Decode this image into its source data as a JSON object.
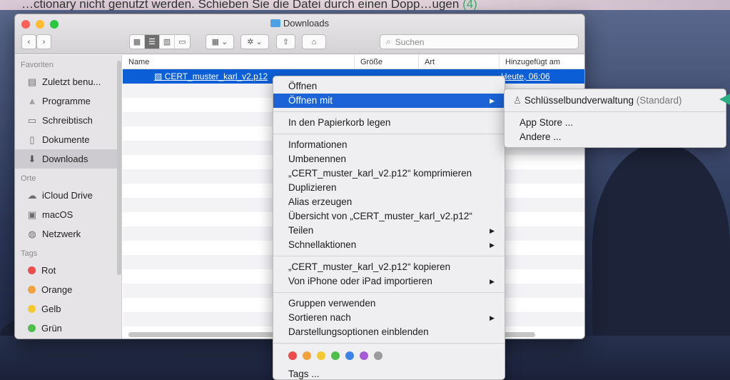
{
  "wallpaper": {
    "caption_main": "…ctionary nicht genutzt werden. Schieben Sie die Datei durch einen Dopp…ugen",
    "caption_accent": "(4)"
  },
  "window": {
    "title": "Downloads",
    "search_placeholder": "Suchen"
  },
  "sidebar": {
    "sections": [
      {
        "title": "Favoriten",
        "items": [
          {
            "label": "Zuletzt benu...",
            "icon": "clock-icon"
          },
          {
            "label": "Programme",
            "icon": "applications-icon"
          },
          {
            "label": "Schreibtisch",
            "icon": "desktop-icon"
          },
          {
            "label": "Dokumente",
            "icon": "document-icon"
          },
          {
            "label": "Downloads",
            "icon": "download-icon",
            "selected": true
          }
        ]
      },
      {
        "title": "Orte",
        "items": [
          {
            "label": "iCloud Drive",
            "icon": "cloud-icon"
          },
          {
            "label": "macOS",
            "icon": "disk-icon"
          },
          {
            "label": "Netzwerk",
            "icon": "network-icon"
          }
        ]
      },
      {
        "title": "Tags",
        "items": [
          {
            "label": "Rot",
            "color": "#ec4c4c"
          },
          {
            "label": "Orange",
            "color": "#f2a23c"
          },
          {
            "label": "Gelb",
            "color": "#f4c92f"
          },
          {
            "label": "Grün",
            "color": "#4dbf4a"
          }
        ]
      }
    ]
  },
  "list": {
    "columns": [
      "Name",
      "Größe",
      "Art",
      "Hinzugefügt am"
    ],
    "file": {
      "name": "CERT_muster_karl_v2.p12",
      "added": "Heute, 06:06"
    }
  },
  "context_menu": {
    "groups": [
      [
        {
          "label": "Öffnen"
        },
        {
          "label": "Öffnen mit",
          "submenu": true,
          "highlighted": true
        }
      ],
      [
        {
          "label": "In den Papierkorb legen"
        }
      ],
      [
        {
          "label": "Informationen"
        },
        {
          "label": "Umbenennen"
        },
        {
          "label": "„CERT_muster_karl_v2.p12“ komprimieren"
        },
        {
          "label": "Duplizieren"
        },
        {
          "label": "Alias erzeugen"
        },
        {
          "label": "Übersicht von „CERT_muster_karl_v2.p12“"
        },
        {
          "label": "Teilen",
          "submenu": true
        },
        {
          "label": "Schnellaktionen",
          "submenu": true
        }
      ],
      [
        {
          "label": "„CERT_muster_karl_v2.p12“ kopieren"
        },
        {
          "label": "Von iPhone oder iPad importieren",
          "submenu": true
        }
      ],
      [
        {
          "label": "Gruppen verwenden"
        },
        {
          "label": "Sortieren nach",
          "submenu": true
        },
        {
          "label": "Darstellungsoptionen einblenden"
        }
      ]
    ],
    "tag_colors": [
      "#ec4c4c",
      "#f2a23c",
      "#f4c92f",
      "#4dbf4a",
      "#3b83e8",
      "#a65ad8",
      "#9b9b9b"
    ],
    "tags_label": "Tags ..."
  },
  "submenu": {
    "app": "Schlüsselbundverwaltung",
    "default_suffix": "(Standard)",
    "items": [
      "App Store ...",
      "Andere ..."
    ]
  },
  "colors": {
    "accent": "#1b63d6",
    "pointer": "#2cae84"
  }
}
